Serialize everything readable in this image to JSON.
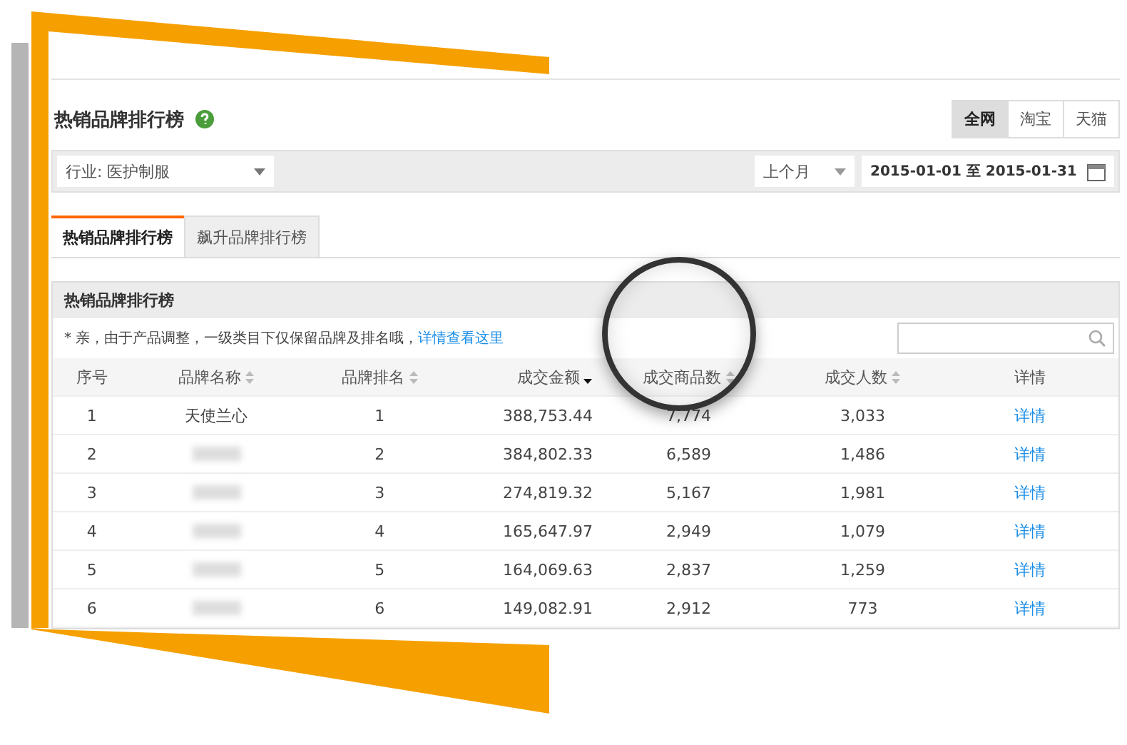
{
  "title": "热销品牌排行榜",
  "source_tabs": [
    {
      "label": "全网",
      "selected": true
    },
    {
      "label": "淘宝",
      "selected": false
    },
    {
      "label": "天猫",
      "selected": false
    }
  ],
  "filter": {
    "industry": "行业: 医护制服",
    "period": "上个月",
    "date_range": "2015-01-01 至 2015-01-31"
  },
  "tabs": [
    {
      "label": "热销品牌排行榜",
      "selected": true
    },
    {
      "label": "飙升品牌排行榜",
      "selected": false
    }
  ],
  "panel": {
    "title": "热销品牌排行榜",
    "notice": "* 亲，由于产品调整，一级类目下仅保留品牌及排名哦，",
    "notice_link": "详情查看这里"
  },
  "table": {
    "columns": [
      {
        "label": "序号",
        "sortable": false
      },
      {
        "label": "品牌名称",
        "sortable": true,
        "sorted_desc": false
      },
      {
        "label": "品牌排名",
        "sortable": true,
        "sorted_desc": false
      },
      {
        "label": "成交金额",
        "sortable": true,
        "sorted_desc": true
      },
      {
        "label": "成交商品数",
        "sortable": true,
        "sorted_desc": false
      },
      {
        "label": "成交人数",
        "sortable": true,
        "sorted_desc": false
      },
      {
        "label": "详情",
        "sortable": false
      }
    ],
    "rows": [
      {
        "index": "1",
        "brand": "天使兰心",
        "rank": "1",
        "amount": "388,753.44",
        "items": "7,774",
        "buyers": "3,033",
        "detail": "详情"
      },
      {
        "index": "2",
        "rank": "2",
        "amount": "384,802.33",
        "items": "6,589",
        "buyers": "1,486",
        "detail": "详情"
      },
      {
        "index": "3",
        "rank": "3",
        "amount": "274,819.32",
        "items": "5,167",
        "buyers": "1,981",
        "detail": "详情"
      },
      {
        "index": "4",
        "rank": "4",
        "amount": "165,647.97",
        "items": "2,949",
        "buyers": "1,079",
        "detail": "详情"
      },
      {
        "index": "5",
        "rank": "5",
        "amount": "164,069.63",
        "items": "2,837",
        "buyers": "1,259",
        "detail": "详情"
      },
      {
        "index": "6",
        "rank": "6",
        "amount": "149,082.91",
        "items": "2,912",
        "buyers": "773",
        "detail": "详情"
      }
    ]
  }
}
